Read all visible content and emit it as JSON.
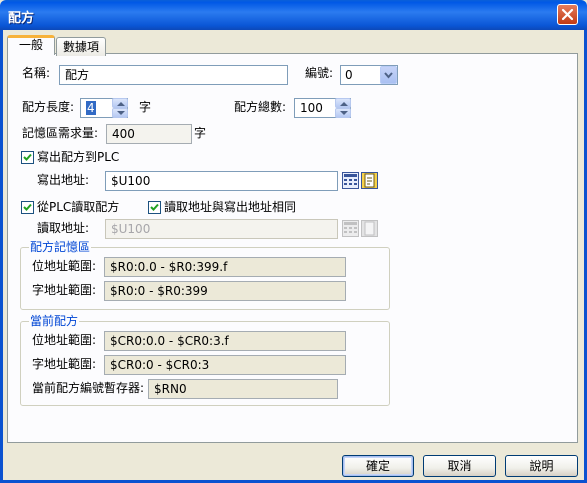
{
  "window": {
    "title": "配方",
    "close_icon": "close-icon"
  },
  "tabs": [
    {
      "label": "一般"
    },
    {
      "label": "數據項"
    }
  ],
  "general": {
    "name_label": "名稱:",
    "name_value": "配方",
    "number_label": "編號:",
    "number_value": "0",
    "length_label": "配方長度:",
    "length_value": "4",
    "length_unit": "字",
    "total_label": "配方總數:",
    "total_value": "100",
    "memory_label": "記憶區需求量:",
    "memory_value": "400",
    "memory_unit": "字",
    "write_checkbox_label": "寫出配方到PLC",
    "write_checked": true,
    "write_addr_label": "寫出地址:",
    "write_addr_value": "$U100",
    "read_checkbox_label": "從PLC讀取配方",
    "read_checked": true,
    "same_addr_checkbox_label": "讀取地址與寫出地址相同",
    "same_addr_checked": true,
    "read_addr_label": "讀取地址:",
    "read_addr_value": "$U100"
  },
  "recipe_memory": {
    "title": "配方記憶區",
    "bit_range_label": "位地址範圍:",
    "bit_range_value": "$R0:0.0 - $R0:399.f",
    "word_range_label": "字地址範圍:",
    "word_range_value": "$R0:0 - $R0:399"
  },
  "current_recipe": {
    "title": "當前配方",
    "bit_range_label": "位地址範圍:",
    "bit_range_value": "$CR0:0.0 - $CR0:3.f",
    "word_range_label": "字地址範圍:",
    "word_range_value": "$CR0:0 - $CR0:3",
    "register_label": "當前配方編號暫存器:",
    "register_value": "$RN0"
  },
  "buttons": {
    "ok": "確定",
    "cancel": "取消",
    "help": "說明"
  },
  "colors": {
    "title_bar": "#0058e6",
    "group_title": "#0046d5",
    "dialog_bg": "#ece9d8",
    "panel_bg": "#fcfcfe"
  }
}
